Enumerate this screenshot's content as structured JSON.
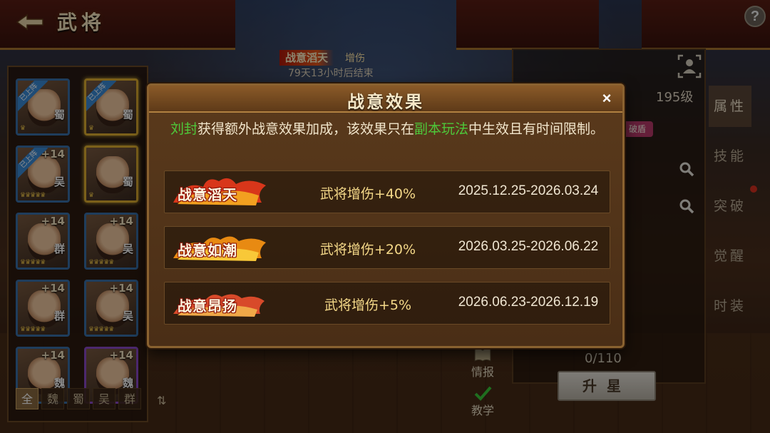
{
  "colors": {
    "accent_gold": "#f4d888",
    "highlight_green": "#4ec83a",
    "frame_brown": "#8a6230",
    "flame_red": "#d8361a",
    "flame_orange": "#f2a020"
  },
  "header": {
    "title": "武将",
    "back_icon": "back-arrow-icon",
    "help_label": "?"
  },
  "event_banner": {
    "tag": "战意滔天",
    "suffix": "增伤",
    "timer": "79天13小时后结束"
  },
  "heroes": [
    {
      "faction": "蜀",
      "plus": "",
      "deployed_label": "已上阵",
      "frame": "blue",
      "stars": "♛"
    },
    {
      "faction": "蜀",
      "plus": "",
      "deployed_label": "已上阵",
      "frame": "gold",
      "stars": "♛"
    },
    {
      "faction": "吴",
      "plus": "+14",
      "deployed_label": "已上阵",
      "frame": "blue",
      "stars": "♛♛♛♛♛"
    },
    {
      "faction": "蜀",
      "plus": "",
      "deployed_label": "",
      "frame": "gold",
      "stars": "♛"
    },
    {
      "faction": "群",
      "plus": "+14",
      "deployed_label": "",
      "frame": "blue",
      "stars": "♛♛♛♛♛"
    },
    {
      "faction": "吴",
      "plus": "+14",
      "deployed_label": "",
      "frame": "blue",
      "stars": "♛♛♛♛♛"
    },
    {
      "faction": "群",
      "plus": "+14",
      "deployed_label": "",
      "frame": "blue",
      "stars": "♛♛♛♛♛"
    },
    {
      "faction": "吴",
      "plus": "+14",
      "deployed_label": "",
      "frame": "blue",
      "stars": "♛♛♛♛♛"
    },
    {
      "faction": "魏",
      "plus": "+14",
      "deployed_label": "",
      "frame": "blue",
      "stars": ""
    },
    {
      "faction": "魏",
      "plus": "+14",
      "deployed_label": "",
      "frame": "purple",
      "stars": ""
    }
  ],
  "filters": {
    "tabs": [
      "全",
      "魏",
      "蜀",
      "吴",
      "群"
    ],
    "active": "全",
    "sort_icon": "sort-arrows-icon"
  },
  "right_panel": {
    "level": "195级",
    "badge": "破盾",
    "progress": "0/110",
    "star_up_label": "升星",
    "intel_label": "情报",
    "tutorial_label": "教学",
    "tabs": [
      "属性",
      "技能",
      "突破",
      "觉醒",
      "时装"
    ],
    "active_tab": "属性"
  },
  "modal": {
    "title": "战意效果",
    "close_label": "×",
    "desc": {
      "hero": "刘封",
      "part1": "获得额外战意效果加成，该效果只在",
      "mode": "副本玩法",
      "part2": "中生效且有时间限制。"
    },
    "effects": [
      {
        "name": "战意滔天",
        "bonus": "武将增伤+40%",
        "dates": "2025.12.25-2026.03.24"
      },
      {
        "name": "战意如潮",
        "bonus": "武将增伤+20%",
        "dates": "2026.03.25-2026.06.22"
      },
      {
        "name": "战意昂扬",
        "bonus": "武将增伤+5%",
        "dates": "2026.06.23-2026.12.19"
      }
    ]
  }
}
